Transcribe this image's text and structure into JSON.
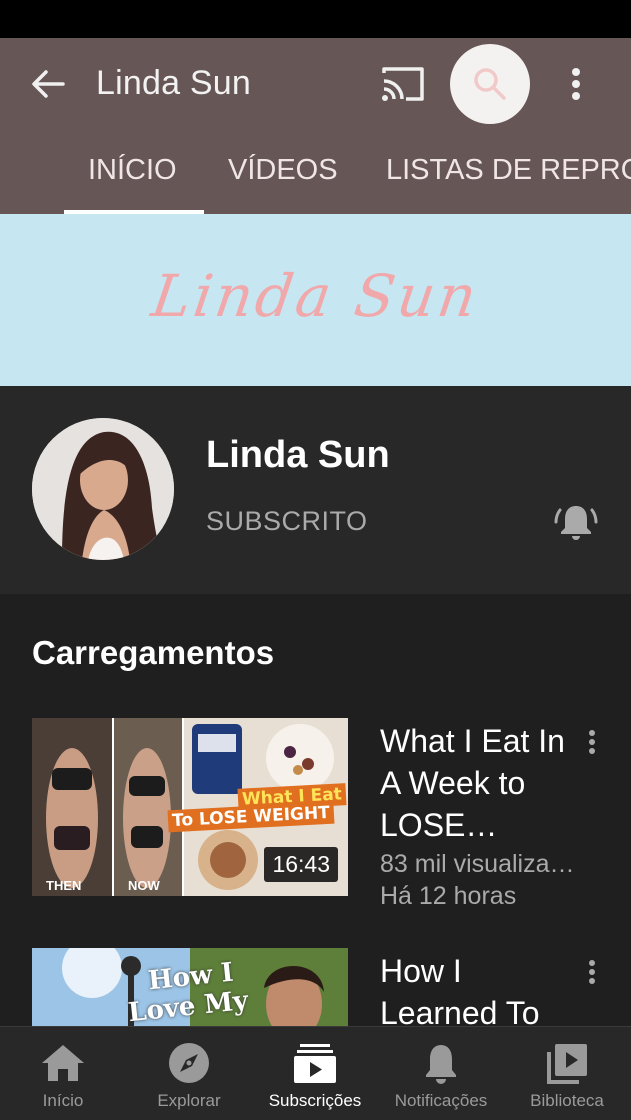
{
  "appbar": {
    "title": "Linda Sun",
    "icons": [
      "arrow-back-icon",
      "cast-icon",
      "search-icon",
      "more-vert-icon"
    ]
  },
  "tabs": [
    {
      "label": "INÍCIO",
      "active": true
    },
    {
      "label": "VÍDEOS",
      "active": false
    },
    {
      "label": "LISTAS DE REPRODUÇÃO",
      "active": false
    }
  ],
  "banner": {
    "text": "Linda Sun"
  },
  "channel": {
    "name": "Linda Sun",
    "subscription_status": "SUBSCRITO"
  },
  "section": {
    "title": "Carregamentos"
  },
  "videos": [
    {
      "title": "What I Eat In A Week to LOSE…",
      "views": "83 mil visualiza…",
      "age": "Há 12 horas",
      "duration": "16:43",
      "thumb_text_1": "What I Eat",
      "thumb_text_2": "To LOSE WEIGHT",
      "thumb_caption_1": "THEN",
      "thumb_caption_2": "NOW"
    },
    {
      "title": "How I Learned To",
      "thumb_text_1": "How I",
      "thumb_text_2": "Love My"
    }
  ],
  "bottomnav": [
    {
      "label": "Início",
      "icon": "home-icon",
      "active": false
    },
    {
      "label": "Explorar",
      "icon": "explore-compass-icon",
      "active": false
    },
    {
      "label": "Subscrições",
      "icon": "subscriptions-icon",
      "active": true
    },
    {
      "label": "Notificações",
      "icon": "bell-icon",
      "active": false
    },
    {
      "label": "Biblioteca",
      "icon": "library-icon",
      "active": false
    }
  ],
  "colors": {
    "appbar": "#675656",
    "banner": "#c6e6f1",
    "banner_text": "#f1a8aa",
    "background": "#1f1f1f",
    "secondary_text": "#aaaaaa"
  }
}
